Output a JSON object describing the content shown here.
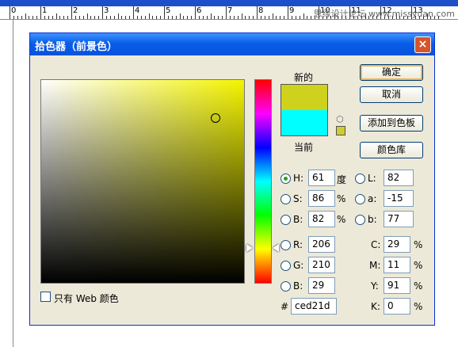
{
  "background": {
    "ruler_numbers": [
      "0",
      "1",
      "2",
      "3",
      "4",
      "5",
      "6",
      "7",
      "8",
      "9",
      "10",
      "11",
      "12",
      "13"
    ],
    "watermark": "思缘设计论坛 www.missyuan.com"
  },
  "dialog": {
    "title": "拾色器（前景色）",
    "close_symbol": "×"
  },
  "preview": {
    "new_label": "新的",
    "current_label": "当前",
    "new_color": "#ced21d",
    "current_color": "#00ffff",
    "web_safe_swatch": "#cccc33"
  },
  "buttons": {
    "ok": "确定",
    "cancel": "取消",
    "add_to_swatches": "添加到色板",
    "color_libraries": "颜色库"
  },
  "hsb": {
    "h_label": "H:",
    "h_value": "61",
    "h_unit": "度",
    "s_label": "S:",
    "s_value": "86",
    "s_unit": "%",
    "b_label": "B:",
    "b_value": "82",
    "b_unit": "%"
  },
  "rgb": {
    "r_label": "R:",
    "r_value": "206",
    "g_label": "G:",
    "g_value": "210",
    "b_label": "B:",
    "b_value": "29"
  },
  "lab": {
    "l_label": "L:",
    "l_value": "82",
    "a_label": "a:",
    "a_value": "-15",
    "b_label": "b:",
    "b_value": "77"
  },
  "cmyk": {
    "c_label": "C:",
    "c_value": "29",
    "c_unit": "%",
    "m_label": "M:",
    "m_value": "11",
    "m_unit": "%",
    "y_label": "Y:",
    "y_value": "91",
    "y_unit": "%",
    "k_label": "K:",
    "k_value": "0",
    "k_unit": "%"
  },
  "hex": {
    "label": "#",
    "value": "ced21d"
  },
  "web_only": {
    "label": "只有 Web 颜色"
  }
}
